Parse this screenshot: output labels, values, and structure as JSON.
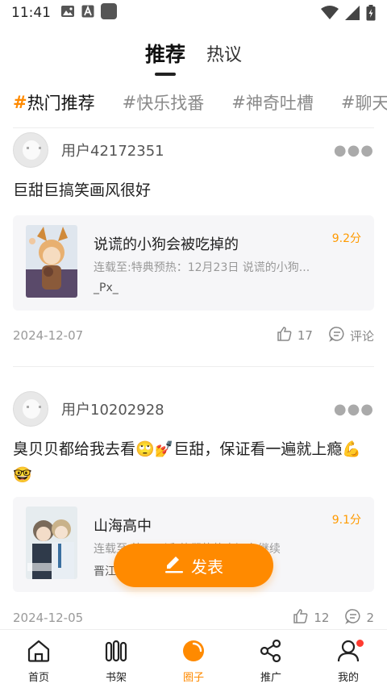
{
  "status_bar": {
    "time": "11:41"
  },
  "top_tabs": [
    {
      "label": "推荐",
      "active": true
    },
    {
      "label": "热议",
      "active": false
    }
  ],
  "tags": [
    {
      "hash": "#",
      "label": "热门推荐",
      "active": true
    },
    {
      "hash": "#",
      "label": "快乐找番",
      "active": false
    },
    {
      "hash": "#",
      "label": "神奇吐槽",
      "active": false
    },
    {
      "hash": "#",
      "label": "聊天",
      "active": false
    }
  ],
  "posts": [
    {
      "username": "用户42172351",
      "text": "巨甜巨搞笑画风很好",
      "book": {
        "title": "说谎的小狗会被吃掉的",
        "score": "9.2分",
        "update": "连载至:特典预热：12月23日 说谎的小狗...",
        "author": "_Px_"
      },
      "date": "2024-12-07",
      "likes": "17",
      "comments": "评论"
    },
    {
      "username": "用户10202928",
      "text": "臭贝贝都给我去看🙄💅巨甜，保证看一遍就上瘾💪🤓",
      "book": {
        "title": "山海高中",
        "score": "9.1分",
        "update": "连载至:第182话 他们的故事还在继续",
        "author": "晋江"
      },
      "date": "2024-12-05",
      "likes": "12",
      "comments": "2"
    }
  ],
  "fab": {
    "label": "发表"
  },
  "bottom_nav": [
    {
      "label": "首页",
      "icon": "home-icon",
      "active": false
    },
    {
      "label": "书架",
      "icon": "bookshelf-icon",
      "active": false
    },
    {
      "label": "圈子",
      "icon": "circle-icon",
      "active": true
    },
    {
      "label": "推广",
      "icon": "share-icon",
      "active": false
    },
    {
      "label": "我的",
      "icon": "profile-icon",
      "active": false
    }
  ],
  "colors": {
    "accent": "#ff8a00",
    "score": "#ff9a00",
    "badge": "#ff3b30"
  }
}
